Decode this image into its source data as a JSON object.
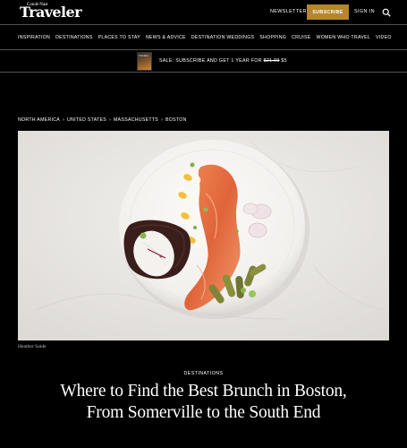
{
  "header": {
    "logo_small": "Condé Nast",
    "logo": "Traveler",
    "newsletter": "NEWSLETTER",
    "subscribe": "SUBSCRIBE",
    "sign_in": "SIGN IN",
    "search_icon": "search-icon",
    "accent_color": "#b5862a"
  },
  "nav": {
    "items": [
      "INSPIRATION",
      "DESTINATIONS",
      "PLACES TO STAY",
      "NEWS & ADVICE",
      "DESTINATION WEDDINGS",
      "SHOPPING",
      "CRUISE",
      "WOMEN WHO TRAVEL",
      "VIDEO"
    ]
  },
  "promo": {
    "cover_title": "Traveler",
    "text_prefix": "SALE: SUBSCRIBE AND GET 1 YEAR FOR",
    "old_price": "$21.99",
    "new_price": "$5"
  },
  "breadcrumb": [
    "NORTH AMERICA",
    "UNITED STATES",
    "MASSACHUSETTS",
    "BOSTON"
  ],
  "article": {
    "photo_credit": "Heather Saide",
    "rubric": "DESTINATIONS",
    "headline": "Where to Find the Best Brunch in Boston, From Somerville to the South End"
  }
}
